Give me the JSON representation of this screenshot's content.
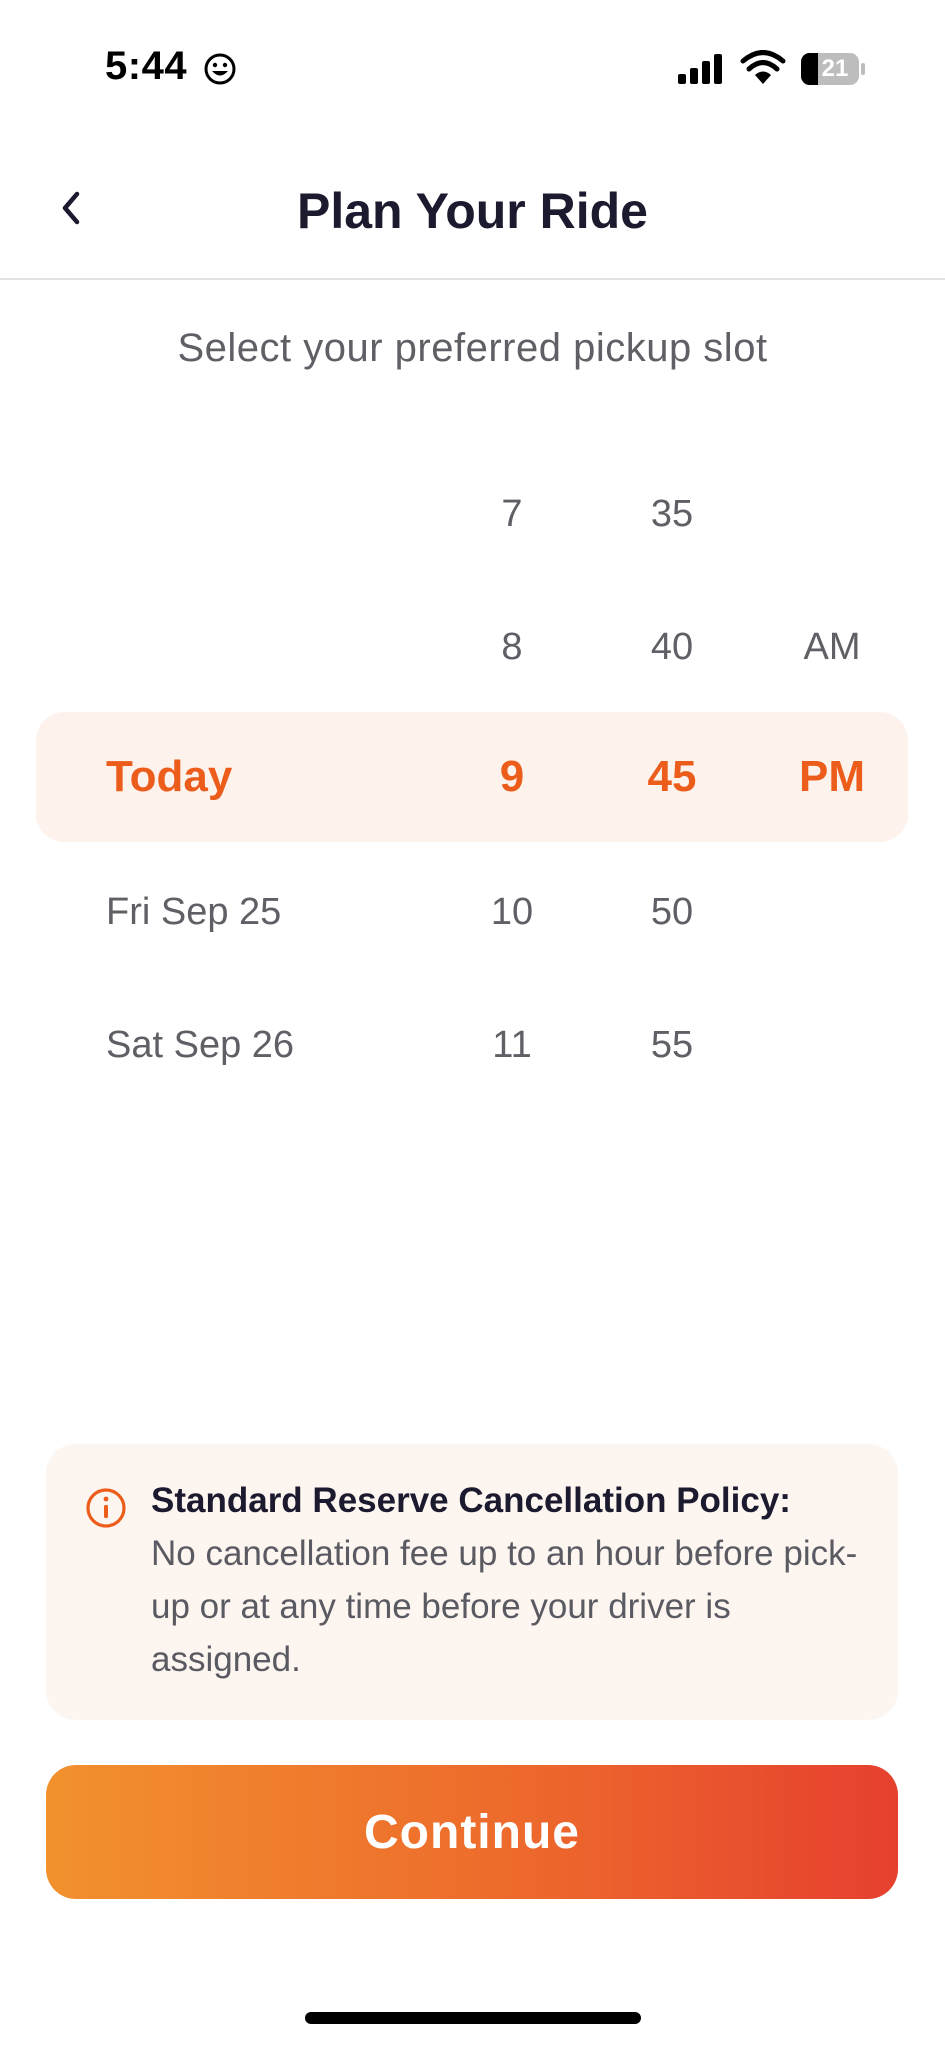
{
  "status_bar": {
    "time": "5:44",
    "battery": "21",
    "icons": [
      "smiley-face-icon",
      "cellular-signal-icon",
      "wifi-icon",
      "battery-icon"
    ]
  },
  "header": {
    "title": "Plan Your Ride",
    "back_icon": "chevron-left-icon"
  },
  "subtitle": "Select your preferred pickup slot",
  "picker": {
    "dates": [
      "",
      "",
      "Today",
      "Fri Sep 25",
      "Sat Sep 26"
    ],
    "hours": [
      "7",
      "8",
      "9",
      "10",
      "11"
    ],
    "minutes": [
      "35",
      "40",
      "45",
      "50",
      "55"
    ],
    "periods": [
      "",
      "AM",
      "PM",
      "",
      ""
    ],
    "selected_index": 2
  },
  "policy": {
    "icon": "info-icon",
    "title": "Standard Reserve Cancellation Policy:",
    "body": "No cancellation fee up to an hour before pick-up or at any time before your driver is assigned."
  },
  "continue_label": "Continue",
  "colors": {
    "accent": "#ec5d1c",
    "highlight_bg": "#fdf3ec",
    "button_gradient_start": "#f2912e",
    "button_gradient_end": "#e6402f",
    "title_text": "#1b1a2e"
  }
}
